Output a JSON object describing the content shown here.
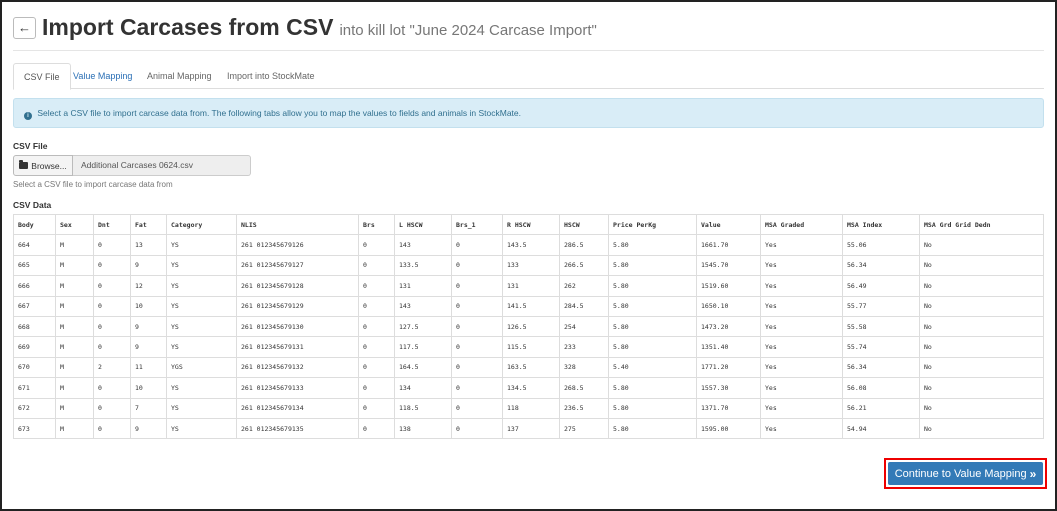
{
  "header": {
    "back_icon": "arrow-left-icon",
    "back_glyph": "←",
    "title": "Import Carcases from CSV",
    "subtitle": "into kill lot \"June 2024 Carcase Import\""
  },
  "tabs": [
    {
      "label": "CSV File",
      "active": true
    },
    {
      "label": "Value Mapping",
      "active": false
    },
    {
      "label": "Animal Mapping",
      "active": false
    },
    {
      "label": "Import into StockMate",
      "active": false
    }
  ],
  "alert": {
    "icon": "info-icon",
    "icon_glyph": "i",
    "text": "Select a CSV file to import carcase data from. The following tabs allow you to map the values to fields and animals in StockMate."
  },
  "csv_file": {
    "label": "CSV File",
    "browse_label": "Browse...",
    "browse_icon": "folder-open-icon",
    "file_name": "Additional Carcases 0624.csv",
    "help_text": "Select a CSV file to import carcase data from"
  },
  "csv_data": {
    "label": "CSV Data",
    "columns": [
      "Body",
      "Sex",
      "Dnt",
      "Fat",
      "Category",
      "NLIS",
      "Brs",
      "L HSCW",
      "Brs_1",
      "R HSCW",
      "HSCW",
      "Price PerKg",
      "Value",
      "MSA Graded",
      "MSA Index",
      "MSA Grd Grid Dedn"
    ],
    "rows": [
      [
        "664",
        "M",
        "0",
        "13",
        "YS",
        "261 012345679126",
        "0",
        "143",
        "0",
        "143.5",
        "286.5",
        "5.80",
        "1661.70",
        "Yes",
        "55.06",
        "No"
      ],
      [
        "665",
        "M",
        "0",
        "9",
        "YS",
        "261 012345679127",
        "0",
        "133.5",
        "0",
        "133",
        "266.5",
        "5.80",
        "1545.70",
        "Yes",
        "56.34",
        "No"
      ],
      [
        "666",
        "M",
        "0",
        "12",
        "YS",
        "261 012345679128",
        "0",
        "131",
        "0",
        "131",
        "262",
        "5.80",
        "1519.60",
        "Yes",
        "56.49",
        "No"
      ],
      [
        "667",
        "M",
        "0",
        "10",
        "YS",
        "261 012345679129",
        "0",
        "143",
        "0",
        "141.5",
        "284.5",
        "5.80",
        "1650.10",
        "Yes",
        "55.77",
        "No"
      ],
      [
        "668",
        "M",
        "0",
        "9",
        "YS",
        "261 012345679130",
        "0",
        "127.5",
        "0",
        "126.5",
        "254",
        "5.80",
        "1473.20",
        "Yes",
        "55.58",
        "No"
      ],
      [
        "669",
        "M",
        "0",
        "9",
        "YS",
        "261 012345679131",
        "0",
        "117.5",
        "0",
        "115.5",
        "233",
        "5.80",
        "1351.40",
        "Yes",
        "55.74",
        "No"
      ],
      [
        "670",
        "M",
        "2",
        "11",
        "YGS",
        "261 012345679132",
        "0",
        "164.5",
        "0",
        "163.5",
        "328",
        "5.40",
        "1771.20",
        "Yes",
        "56.34",
        "No"
      ],
      [
        "671",
        "M",
        "0",
        "10",
        "YS",
        "261 012345679133",
        "0",
        "134",
        "0",
        "134.5",
        "268.5",
        "5.80",
        "1557.30",
        "Yes",
        "56.08",
        "No"
      ],
      [
        "672",
        "M",
        "0",
        "7",
        "YS",
        "261 012345679134",
        "0",
        "118.5",
        "0",
        "118",
        "236.5",
        "5.80",
        "1371.70",
        "Yes",
        "56.21",
        "No"
      ],
      [
        "673",
        "M",
        "0",
        "9",
        "YS",
        "261 012345679135",
        "0",
        "138",
        "0",
        "137",
        "275",
        "5.80",
        "1595.00",
        "Yes",
        "54.94",
        "No"
      ]
    ]
  },
  "actions": {
    "continue_label": "Continue to Value Mapping",
    "continue_icon": "double-chevron-right-icon",
    "continue_glyph": "»",
    "highlight_color": "#ee0000",
    "button_color": "#337ab7"
  }
}
